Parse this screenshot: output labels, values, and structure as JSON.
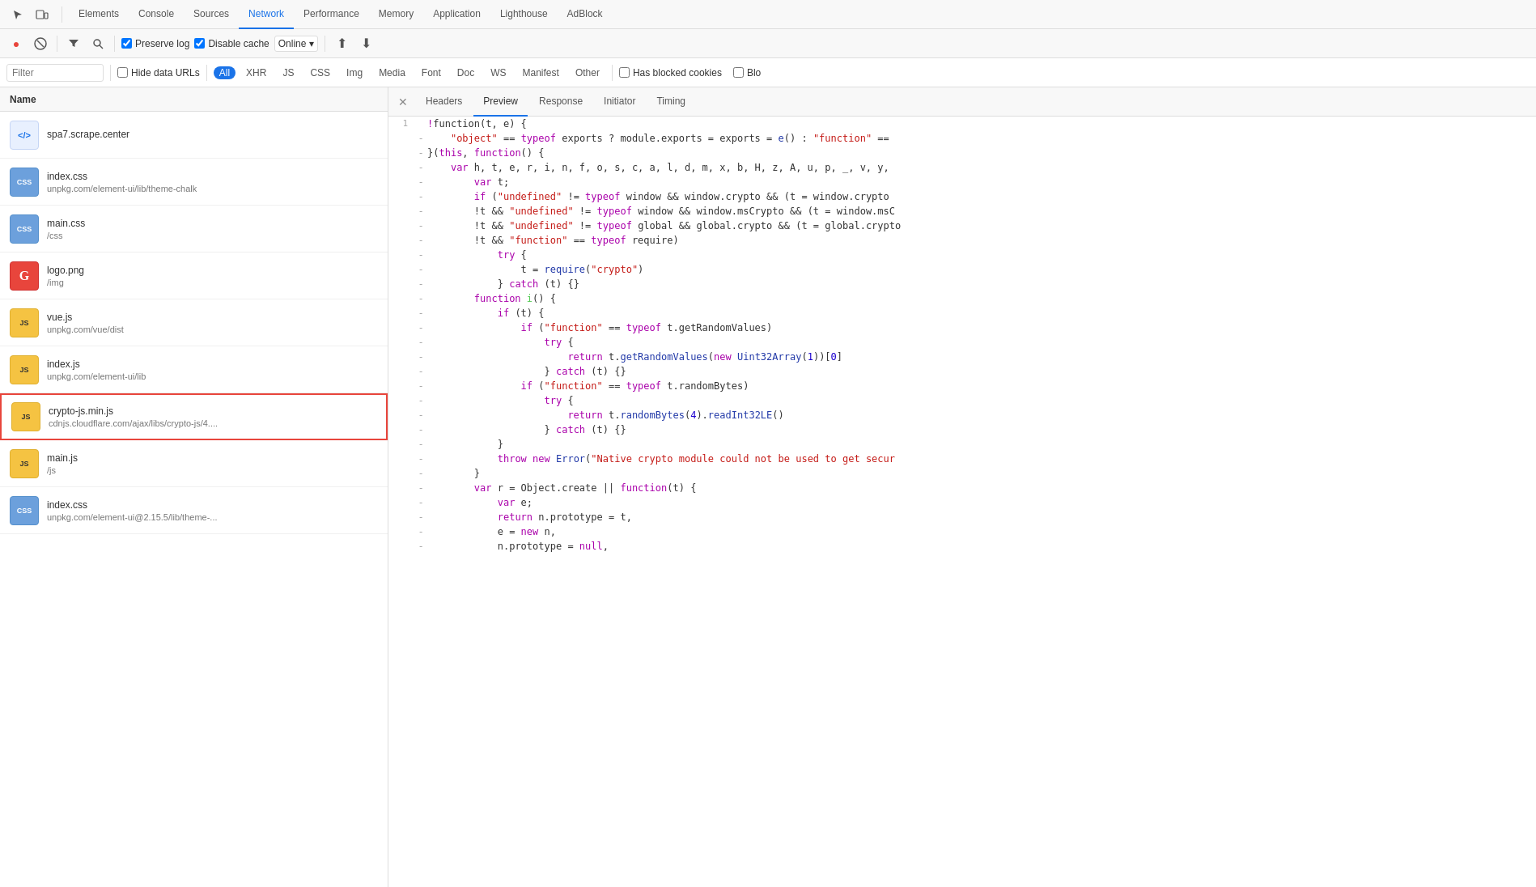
{
  "tabs": {
    "items": [
      {
        "label": "Elements",
        "active": false
      },
      {
        "label": "Console",
        "active": false
      },
      {
        "label": "Sources",
        "active": false
      },
      {
        "label": "Network",
        "active": true
      },
      {
        "label": "Performance",
        "active": false
      },
      {
        "label": "Memory",
        "active": false
      },
      {
        "label": "Application",
        "active": false
      },
      {
        "label": "Lighthouse",
        "active": false
      },
      {
        "label": "AdBlock",
        "active": false
      }
    ]
  },
  "toolbar": {
    "preserve_log": "Preserve log",
    "disable_cache": "Disable cache",
    "online_label": "Online"
  },
  "filter": {
    "placeholder": "Filter",
    "hide_data_urls": "Hide data URLs",
    "types": [
      "All",
      "XHR",
      "JS",
      "CSS",
      "Img",
      "Media",
      "Font",
      "Doc",
      "WS",
      "Manifest",
      "Other"
    ],
    "active_type": "All",
    "has_blocked": "Has blocked cookies",
    "blocked_label": "Blo"
  },
  "file_list": {
    "header": "Name",
    "files": [
      {
        "name": "spa7.scrape.center",
        "path": "",
        "type": "html",
        "icon_text": "</>",
        "selected": false
      },
      {
        "name": "index.css",
        "path": "unpkg.com/element-ui/lib/theme-chalk",
        "type": "css",
        "icon_text": "CSS",
        "selected": false
      },
      {
        "name": "main.css",
        "path": "/css",
        "type": "css",
        "icon_text": "CSS",
        "selected": false
      },
      {
        "name": "logo.png",
        "path": "/img",
        "type": "png",
        "icon_text": "G",
        "selected": false
      },
      {
        "name": "vue.js",
        "path": "unpkg.com/vue/dist",
        "type": "js",
        "icon_text": "JS",
        "selected": false
      },
      {
        "name": "index.js",
        "path": "unpkg.com/element-ui/lib",
        "type": "js",
        "icon_text": "JS",
        "selected": false
      },
      {
        "name": "crypto-js.min.js",
        "path": "cdnjs.cloudflare.com/ajax/libs/crypto-js/4....",
        "type": "js",
        "icon_text": "JS",
        "selected": true
      },
      {
        "name": "main.js",
        "path": "/js",
        "type": "js",
        "icon_text": "JS",
        "selected": false
      },
      {
        "name": "index.css",
        "path": "unpkg.com/element-ui@2.15.5/lib/theme-...",
        "type": "css",
        "icon_text": "CSS",
        "selected": false
      }
    ]
  },
  "code_panel": {
    "tabs": [
      {
        "label": "Headers",
        "active": false
      },
      {
        "label": "Preview",
        "active": true
      },
      {
        "label": "Response",
        "active": false
      },
      {
        "label": "Initiator",
        "active": false
      },
      {
        "label": "Timing",
        "active": false
      }
    ],
    "lines": [
      {
        "num": "1",
        "indicator": " ",
        "code": "!function(t, e) {"
      },
      {
        "num": " ",
        "indicator": "-",
        "code": "    \"object\" == typeof exports ? module.exports = exports = e() : \"function\" =="
      },
      {
        "num": " ",
        "indicator": "-",
        "code": "}(this, function() {"
      },
      {
        "num": " ",
        "indicator": "-",
        "code": "    var h, t, e, r, i, n, f, o, s, c, a, l, d, m, x, b, H, z, A, u, p, _, v, y,"
      },
      {
        "num": " ",
        "indicator": "-",
        "code": "        var t;"
      },
      {
        "num": " ",
        "indicator": "-",
        "code": "        if (\"undefined\" != typeof window && window.crypto && (t = window.crypto"
      },
      {
        "num": " ",
        "indicator": "-",
        "code": "        !t && \"undefined\" != typeof window && window.msCrypto && (t = window.msC"
      },
      {
        "num": " ",
        "indicator": "-",
        "code": "        !t && \"undefined\" != typeof global && global.crypto && (t = global.crypto"
      },
      {
        "num": " ",
        "indicator": "-",
        "code": "        !t && \"function\" == typeof require)"
      },
      {
        "num": " ",
        "indicator": "-",
        "code": "            try {"
      },
      {
        "num": " ",
        "indicator": "-",
        "code": "                t = require(\"crypto\")"
      },
      {
        "num": " ",
        "indicator": "-",
        "code": "            } catch (t) {}"
      },
      {
        "num": " ",
        "indicator": "-",
        "code": "        function i() {"
      },
      {
        "num": " ",
        "indicator": "-",
        "code": "            if (t) {"
      },
      {
        "num": " ",
        "indicator": "-",
        "code": "                if (\"function\" == typeof t.getRandomValues)"
      },
      {
        "num": " ",
        "indicator": "-",
        "code": "                    try {"
      },
      {
        "num": " ",
        "indicator": "-",
        "code": "                        return t.getRandomValues(new Uint32Array(1))[0]"
      },
      {
        "num": " ",
        "indicator": "-",
        "code": "                    } catch (t) {}"
      },
      {
        "num": " ",
        "indicator": "-",
        "code": "                if (\"function\" == typeof t.randomBytes)"
      },
      {
        "num": " ",
        "indicator": "-",
        "code": "                    try {"
      },
      {
        "num": " ",
        "indicator": "-",
        "code": "                        return t.randomBytes(4).readInt32LE()"
      },
      {
        "num": " ",
        "indicator": "-",
        "code": "                    } catch (t) {}"
      },
      {
        "num": " ",
        "indicator": "-",
        "code": "            }"
      },
      {
        "num": " ",
        "indicator": "-",
        "code": "            throw new Error(\"Native crypto module could not be used to get secur"
      },
      {
        "num": " ",
        "indicator": "-",
        "code": "        }"
      },
      {
        "num": " ",
        "indicator": "-",
        "code": "        var r = Object.create || function(t) {"
      },
      {
        "num": " ",
        "indicator": "-",
        "code": "            var e;"
      },
      {
        "num": " ",
        "indicator": "-",
        "code": "            return n.prototype = t,"
      },
      {
        "num": " ",
        "indicator": "-",
        "code": "            e = new n,"
      },
      {
        "num": " ",
        "indicator": "-",
        "code": "            n.prototype = null,"
      }
    ]
  }
}
